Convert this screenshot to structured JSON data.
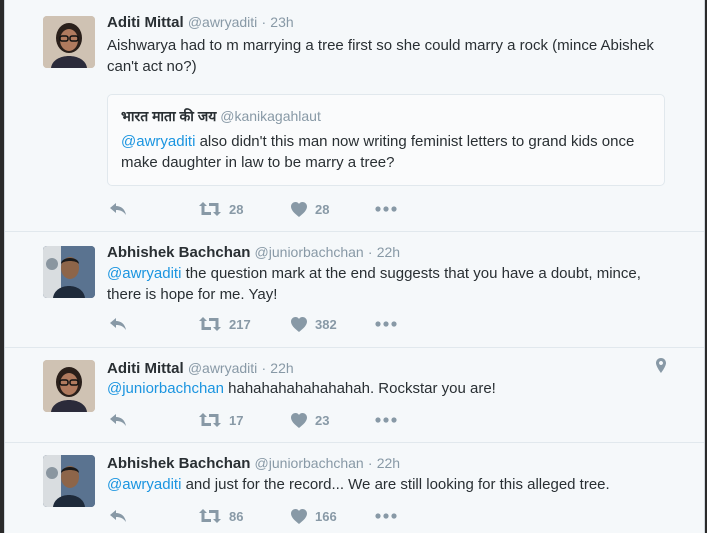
{
  "tweets": [
    {
      "name": "Aditi Mittal",
      "handle": "@awryaditi",
      "dot": "·",
      "time": "23h",
      "text": "Aishwarya had to m marrying a tree first so she could marry a rock (mince Abishek can't act no?)",
      "quote": {
        "name": "भारत माता की जय",
        "handle": "@kanikagahlaut",
        "text_mention": "@awryaditi",
        "text_rest": " also didn't this man now writing feminist letters to grand kids once make daughter in law to be marry a tree?"
      },
      "retweets": "28",
      "likes": "28",
      "avatar": "woman"
    },
    {
      "name": "Abhishek Bachchan",
      "handle": "@juniorbachchan",
      "dot": "·",
      "time": "22h",
      "text_mention": "@awryaditi",
      "text_rest": " the question mark at the end suggests that you have a doubt, mince, there is hope for me. Yay!",
      "retweets": "217",
      "likes": "382",
      "avatar": "man"
    },
    {
      "name": "Aditi Mittal",
      "handle": "@awryaditi",
      "dot": "·",
      "time": "22h",
      "text_mention": "@juniorbachchan",
      "text_rest": " hahahahahahahahah. Rockstar you are!",
      "retweets": "17",
      "likes": "23",
      "avatar": "woman"
    },
    {
      "name": "Abhishek Bachchan",
      "handle": "@juniorbachchan",
      "dot": "·",
      "time": "22h",
      "text_mention": "@awryaditi",
      "text_rest": " and just for the record... We are still looking for this alleged tree.",
      "retweets": "86",
      "likes": "166",
      "avatar": "man"
    }
  ],
  "colors": {
    "accent": "#1b95e0",
    "muted": "#8899a6",
    "text": "#292f33",
    "background": "#f5f8fa"
  },
  "icons": [
    "reply-icon",
    "retweet-icon",
    "heart-icon",
    "more-icon",
    "location-pin-icon"
  ]
}
